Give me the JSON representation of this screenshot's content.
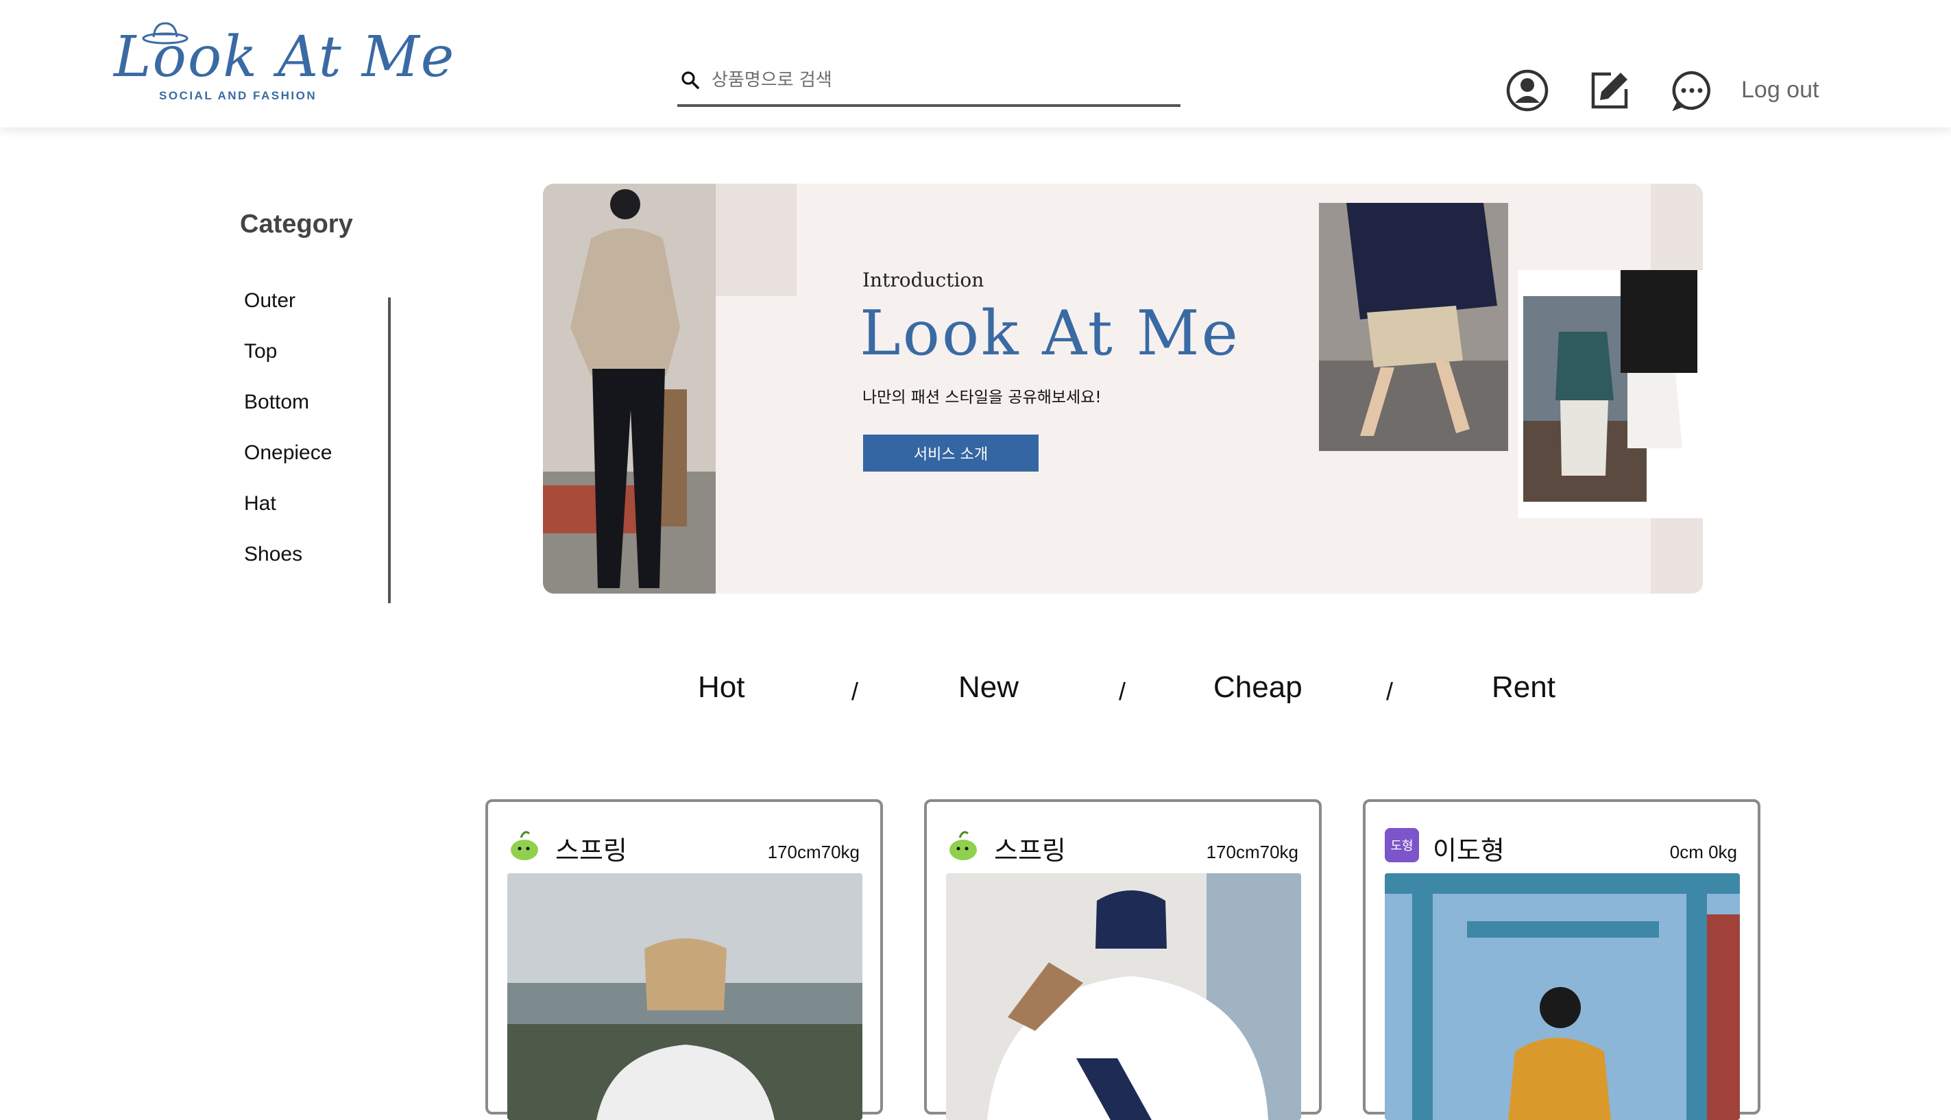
{
  "header": {
    "logo_text": "Look At Me",
    "logo_tagline": "SOCIAL AND FASHION",
    "search_placeholder": "상품명으로 검색",
    "logout_label": "Log out",
    "icons": [
      "user-profile-icon",
      "edit-icon",
      "chat-icon"
    ]
  },
  "sidebar": {
    "title": "Category",
    "items": [
      {
        "label": "Outer"
      },
      {
        "label": "Top"
      },
      {
        "label": "Bottom"
      },
      {
        "label": "Onepiece"
      },
      {
        "label": "Hat"
      },
      {
        "label": "Shoes"
      }
    ]
  },
  "banner": {
    "intro": "Introduction",
    "title": "Look At Me",
    "subtitle": "나만의 패션 스타일을 공유해보세요!",
    "button_label": "서비스 소개"
  },
  "tabs": {
    "items": [
      "Hot",
      "New",
      "Cheap",
      "Rent"
    ],
    "separator": "/"
  },
  "cards": [
    {
      "name": "스프링",
      "meta": "170cm70kg",
      "avatar": "green-character-avatar"
    },
    {
      "name": "스프링",
      "meta": "170cm70kg",
      "avatar": "green-character-avatar"
    },
    {
      "name": "이도형",
      "meta": "0cm 0kg",
      "avatar": "purple-initial-avatar",
      "avatar_text": "도형"
    }
  ],
  "colors": {
    "brand": "#3a6aa4",
    "button": "#3566a4",
    "banner_bg": "#f6f1ef",
    "avatar_purple": "#7b55c9"
  }
}
